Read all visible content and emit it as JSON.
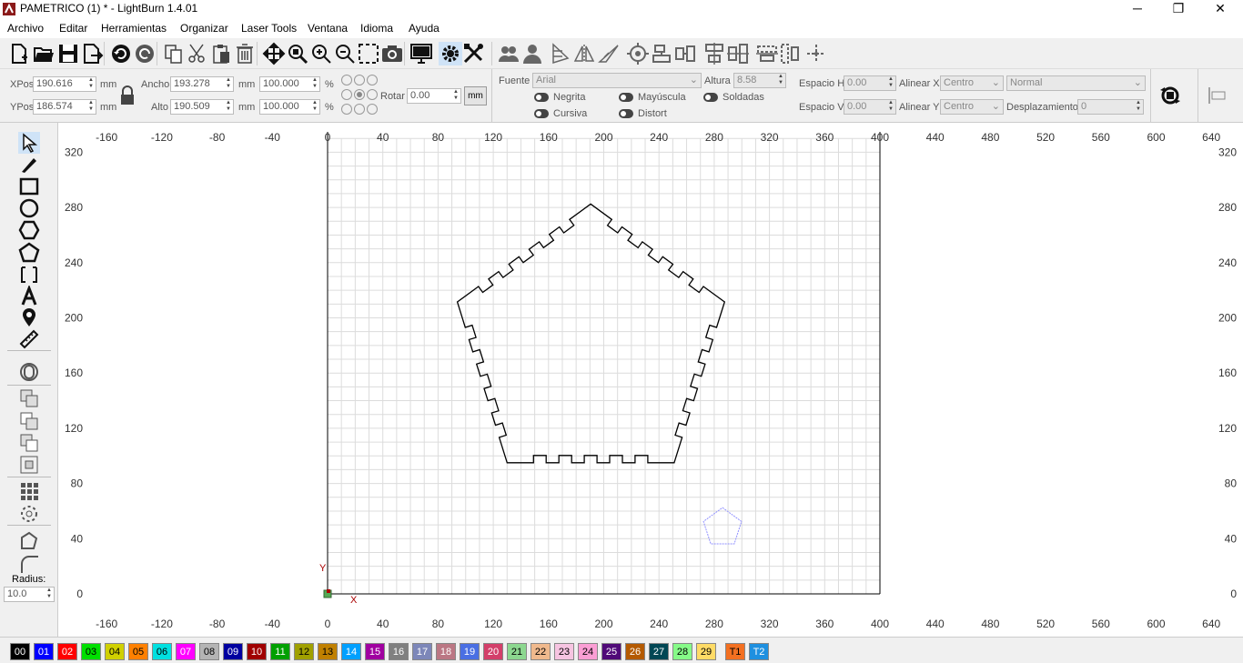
{
  "window": {
    "title": "PAMETRICO (1) * - LightBurn 1.4.01",
    "minimize": "─",
    "restore": "❐",
    "close": "✕"
  },
  "menu": [
    "Archivo",
    "Editar",
    "Herramientas",
    "Organizar",
    "Laser Tools",
    "Ventana",
    "Idioma",
    "Ayuda"
  ],
  "toolbar_icons": [
    "new-file",
    "open-file",
    "save-file",
    "export-file",
    "undo",
    "redo",
    "copy",
    "cut",
    "paste",
    "delete",
    "move",
    "zoom-in-selection",
    "zoom-in",
    "zoom-out",
    "zoom-frame",
    "camera",
    "device-monitor",
    "settings-gear",
    "machine-settings-tools",
    "group-users",
    "user",
    "mirror-horizontal",
    "mirror-vertical",
    "rotate-mirror",
    "center-target",
    "align-left",
    "distribute-horizontal",
    "align-top",
    "align-center",
    "distribute",
    "distribute-vertical",
    "move-laser"
  ],
  "props": {
    "xpos_label": "XPos",
    "xpos": "190.616",
    "ypos_label": "YPos",
    "ypos": "186.574",
    "unit": "mm",
    "width_label": "Ancho",
    "width": "193.278",
    "height_label": "Alto",
    "height": "190.509",
    "scale_w": "100.000",
    "scale_h": "100.000",
    "percent": "%",
    "rotate_label": "Rotar",
    "rotate": "0.00",
    "mm_button": "mm",
    "font_label": "Fuente",
    "font": "Arial",
    "height_text_label": "Altura",
    "height_text": "8.58",
    "bold_label": "Negrita",
    "italic_label": "Cursiva",
    "upper_label": "Mayúscula",
    "distort_label": "Distort",
    "welded_label": "Soldadas",
    "hspace_label": "Espacio H",
    "hspace": "0.00",
    "vspace_label": "Espacio V",
    "vspace": "0.00",
    "alignx_label": "Alinear X",
    "alignx": "Centro",
    "aligny_label": "Alinear Y",
    "aligny": "Centro",
    "mode": "Normal",
    "offset_label": "Desplazamiento",
    "offset": "0"
  },
  "left_tools": {
    "icons": [
      "select-arrow",
      "pen-draw",
      "rectangle",
      "ellipse",
      "polygon",
      "pentagon",
      "frame-corners",
      "text-A",
      "location-pin",
      "measure-ruler",
      "offset-ring",
      "weld",
      "boolean-union",
      "boolean-subtract",
      "boolean-intersect",
      "grid-array",
      "circular-array",
      "convert-path",
      "corner-radius"
    ],
    "radius_label": "Radius:",
    "radius": "10.0"
  },
  "canvas": {
    "x_ticks": [
      "-160",
      "-120",
      "-80",
      "-40",
      "0",
      "40",
      "80",
      "120",
      "160",
      "200",
      "240",
      "280",
      "320",
      "360",
      "400",
      "440",
      "480",
      "520",
      "560",
      "600",
      "640"
    ],
    "y_ticks": [
      "320",
      "280",
      "240",
      "200",
      "160",
      "120",
      "80",
      "40",
      "0"
    ],
    "x_axis_label": "X",
    "y_axis_label": "Y",
    "shape_color": "#000000",
    "preview_shape_color": "#9090ff"
  },
  "palette": [
    {
      "label": "00",
      "bg": "#000000",
      "fg": "#ffffff"
    },
    {
      "label": "01",
      "bg": "#0000ff",
      "fg": "#ffffff"
    },
    {
      "label": "02",
      "bg": "#ff0000",
      "fg": "#ffffff"
    },
    {
      "label": "03",
      "bg": "#00e000",
      "fg": "#000000"
    },
    {
      "label": "04",
      "bg": "#d0d000",
      "fg": "#000000"
    },
    {
      "label": "05",
      "bg": "#ff8000",
      "fg": "#000000"
    },
    {
      "label": "06",
      "bg": "#00e0e0",
      "fg": "#000000"
    },
    {
      "label": "07",
      "bg": "#ff00ff",
      "fg": "#ffffff"
    },
    {
      "label": "08",
      "bg": "#b4b4b4",
      "fg": "#000000"
    },
    {
      "label": "09",
      "bg": "#0000a0",
      "fg": "#ffffff"
    },
    {
      "label": "10",
      "bg": "#a00000",
      "fg": "#ffffff"
    },
    {
      "label": "11",
      "bg": "#00a000",
      "fg": "#ffffff"
    },
    {
      "label": "12",
      "bg": "#a0a000",
      "fg": "#000000"
    },
    {
      "label": "13",
      "bg": "#c08000",
      "fg": "#000000"
    },
    {
      "label": "14",
      "bg": "#00a0ff",
      "fg": "#ffffff"
    },
    {
      "label": "15",
      "bg": "#a000a0",
      "fg": "#ffffff"
    },
    {
      "label": "16",
      "bg": "#808080",
      "fg": "#ffffff"
    },
    {
      "label": "17",
      "bg": "#7d87b9",
      "fg": "#ffffff"
    },
    {
      "label": "18",
      "bg": "#bb7784",
      "fg": "#ffffff"
    },
    {
      "label": "19",
      "bg": "#4a6fe3",
      "fg": "#ffffff"
    },
    {
      "label": "20",
      "bg": "#d33f6a",
      "fg": "#ffffff"
    },
    {
      "label": "21",
      "bg": "#8cd78f",
      "fg": "#000000"
    },
    {
      "label": "22",
      "bg": "#f0b98d",
      "fg": "#000000"
    },
    {
      "label": "23",
      "bg": "#f6c4e1",
      "fg": "#000000"
    },
    {
      "label": "24",
      "bg": "#fa9ed4",
      "fg": "#000000"
    },
    {
      "label": "25",
      "bg": "#500a78",
      "fg": "#ffffff"
    },
    {
      "label": "26",
      "bg": "#b45a00",
      "fg": "#ffffff"
    },
    {
      "label": "27",
      "bg": "#004754",
      "fg": "#ffffff"
    },
    {
      "label": "28",
      "bg": "#86fa88",
      "fg": "#000000"
    },
    {
      "label": "29",
      "bg": "#ffdb66",
      "fg": "#000000"
    },
    {
      "label": "T1",
      "bg": "#f37021",
      "fg": "#000000"
    },
    {
      "label": "T2",
      "bg": "#1e90e0",
      "fg": "#ffffff"
    }
  ]
}
